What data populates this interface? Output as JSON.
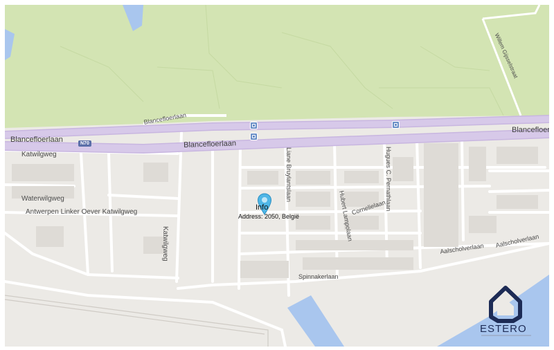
{
  "colors": {
    "land": "#eceae6",
    "park": "#d3e4b3",
    "water": "#a9c6ee",
    "road": "#ffffff",
    "highway": "#d7c9e9",
    "pin": "#4fb6e6",
    "brand": "#1d2b55"
  },
  "roads": {
    "blancefloerlaan_top": "Blancefloerlaan",
    "blancefloerlaan_right": "Blancefloerlaan",
    "blancefloerlaan_main": "Blancefloerlaan",
    "blancefloerlaan_ramp": "Blancefloerlaan",
    "shield": "N70",
    "katwilgweg": "Katwilgweg",
    "waterwilgweg": "Waterwilgweg",
    "antwerpen": "Antwerpen Linker Oever Katwilgweg",
    "katwilgweg_vertical": "Katwilgweg",
    "liane": "Liane Bruylantslaan",
    "hugues": "Hugues C. Pernathlaan",
    "hubert": "Hubert Lampolaan",
    "cornelie": "Cornelielaan",
    "aalscholverlaan_1": "Aalscholverlaan",
    "aalscholverlaan_2": "Aalscholverlaan",
    "spinnaker": "Spinnakerlaan",
    "gittestraat": "Willem Gijsselstraat"
  },
  "marker": {
    "icon": "map-pin-icon",
    "title": "Info",
    "address": "Address: 2050, België"
  },
  "brand": {
    "icon": "estero-house-icon",
    "name": "ESTERO"
  }
}
